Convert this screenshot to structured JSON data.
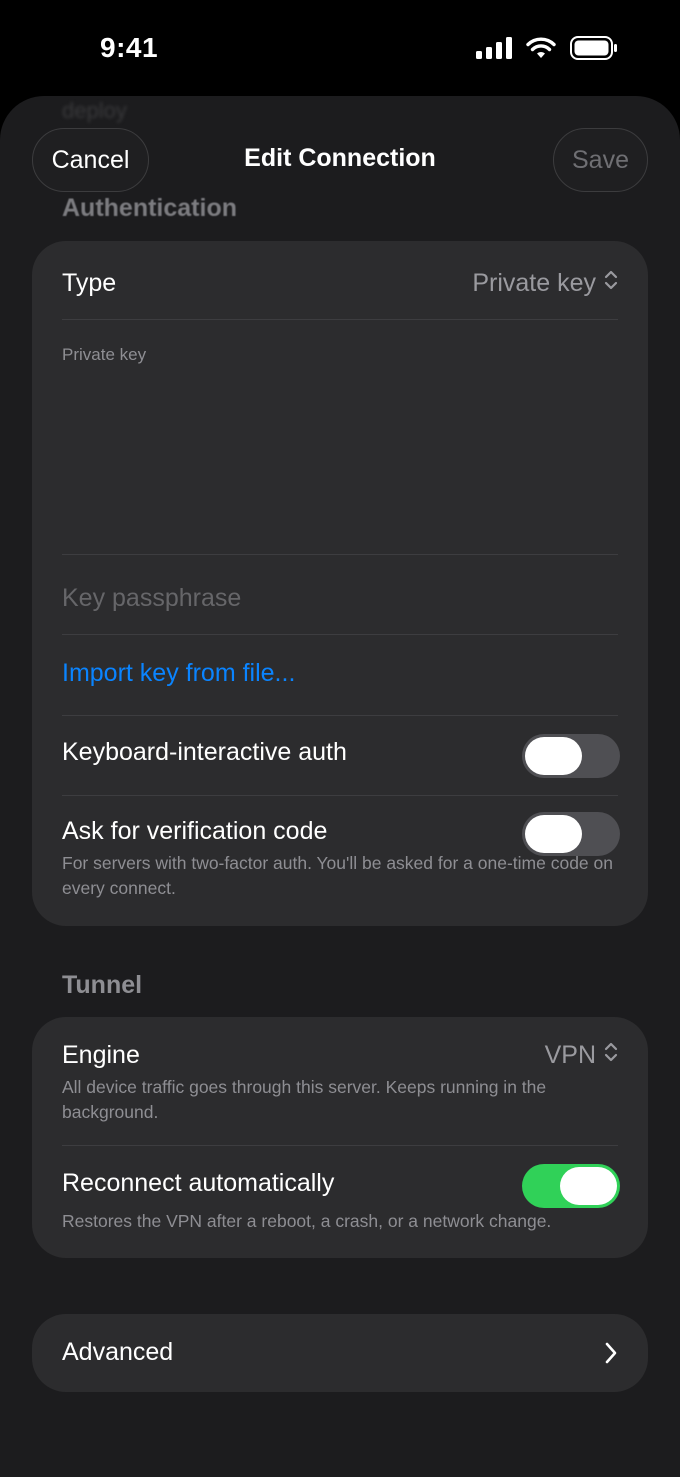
{
  "status_bar": {
    "time": "9:41"
  },
  "sheet": {
    "ghost_title": "deploy",
    "title": "Edit Connection",
    "cancel_label": "Cancel",
    "save_label": "Save"
  },
  "authentication": {
    "header": "Authentication",
    "type_label": "Type",
    "type_value": "Private key",
    "private_key_label": "Private key",
    "private_key_value": "",
    "passphrase_placeholder": "Key passphrase",
    "import_label": "Import key from file...",
    "kbd_interactive_label": "Keyboard-interactive auth",
    "kbd_interactive_on": false,
    "verification_label": "Ask for verification code",
    "verification_on": false,
    "verification_note": "For servers with two-factor auth. You'll be asked for a one-time code on every connect."
  },
  "tunnel": {
    "header": "Tunnel",
    "engine_label": "Engine",
    "engine_value": "VPN",
    "engine_note": "All device traffic goes through this server. Keeps running in the background.",
    "reconnect_label": "Reconnect automatically",
    "reconnect_on": true,
    "reconnect_note": "Restores the VPN after a reboot, a crash, or a network change."
  },
  "advanced": {
    "label": "Advanced"
  },
  "colors": {
    "accent_link": "#0a84ff",
    "toggle_on": "#30d158",
    "card_bg": "#2c2c2e",
    "sheet_bg": "#1c1c1e"
  },
  "icons": [
    "cellular-signal-icon",
    "wifi-icon",
    "battery-icon",
    "updown-chevron-icon",
    "chevron-right-icon"
  ]
}
